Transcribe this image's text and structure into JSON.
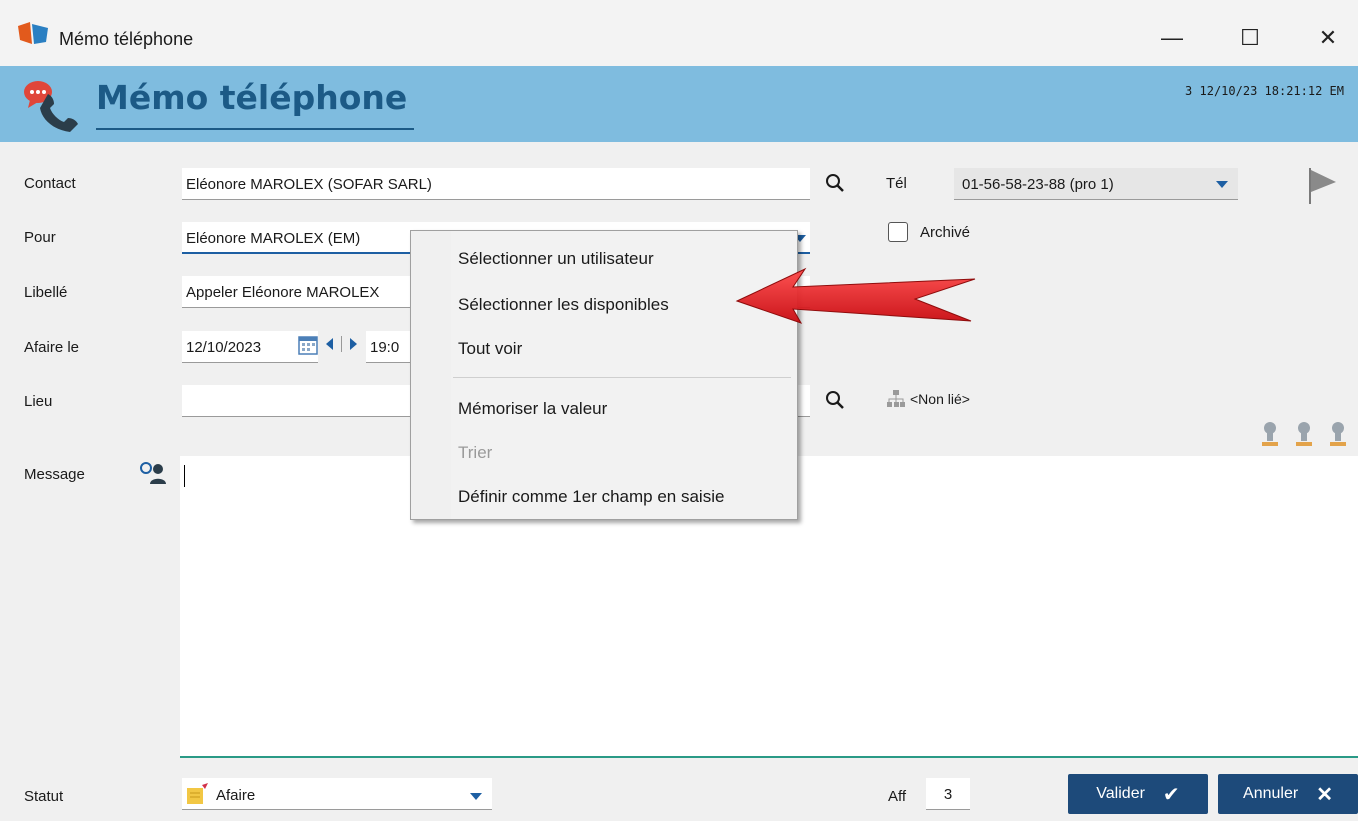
{
  "window": {
    "title": "Mémo téléphone",
    "controls": {
      "minimize": "—",
      "maximize": "☐",
      "close": "✕"
    }
  },
  "header": {
    "title": "Mémo téléphone",
    "stamp": "3 12/10/23 18:21:12 EM"
  },
  "form": {
    "contact": {
      "label": "Contact",
      "value": "Eléonore MAROLEX (SOFAR SARL)"
    },
    "tel": {
      "label": "Tél",
      "value": "01-56-58-23-88 (pro 1)"
    },
    "pour": {
      "label": "Pour",
      "value": "Eléonore MAROLEX (EM)"
    },
    "archive": {
      "label": "Archivé",
      "checked": false
    },
    "libelle": {
      "label": "Libellé",
      "value": "Appeler Eléonore MAROLEX"
    },
    "afaire": {
      "label": "Afaire le",
      "date": "12/10/2023",
      "time": "19:0"
    },
    "lieu": {
      "label": "Lieu",
      "value": "",
      "link": "<Non lié>"
    },
    "message": {
      "label": "Message",
      "value": ""
    },
    "statut": {
      "label": "Statut",
      "value": "Afaire"
    },
    "aff": {
      "label": "Aff",
      "value": "3"
    }
  },
  "buttons": {
    "valider": "Valider",
    "annuler": "Annuler"
  },
  "context_menu": {
    "items": [
      {
        "label": "Sélectionner un utilisateur",
        "enabled": true
      },
      {
        "label": "Sélectionner les disponibles",
        "enabled": true
      },
      {
        "label": "Tout voir",
        "enabled": true
      },
      {
        "label": "Mémoriser la valeur",
        "enabled": true
      },
      {
        "label": "Trier",
        "enabled": false
      },
      {
        "label": "Définir comme 1er champ en saisie",
        "enabled": true
      }
    ]
  },
  "colors": {
    "header_band": "#7fbcdf",
    "header_title": "#1c5a86",
    "button_bg": "#1d4a7a",
    "arrow": "#e8141c"
  }
}
